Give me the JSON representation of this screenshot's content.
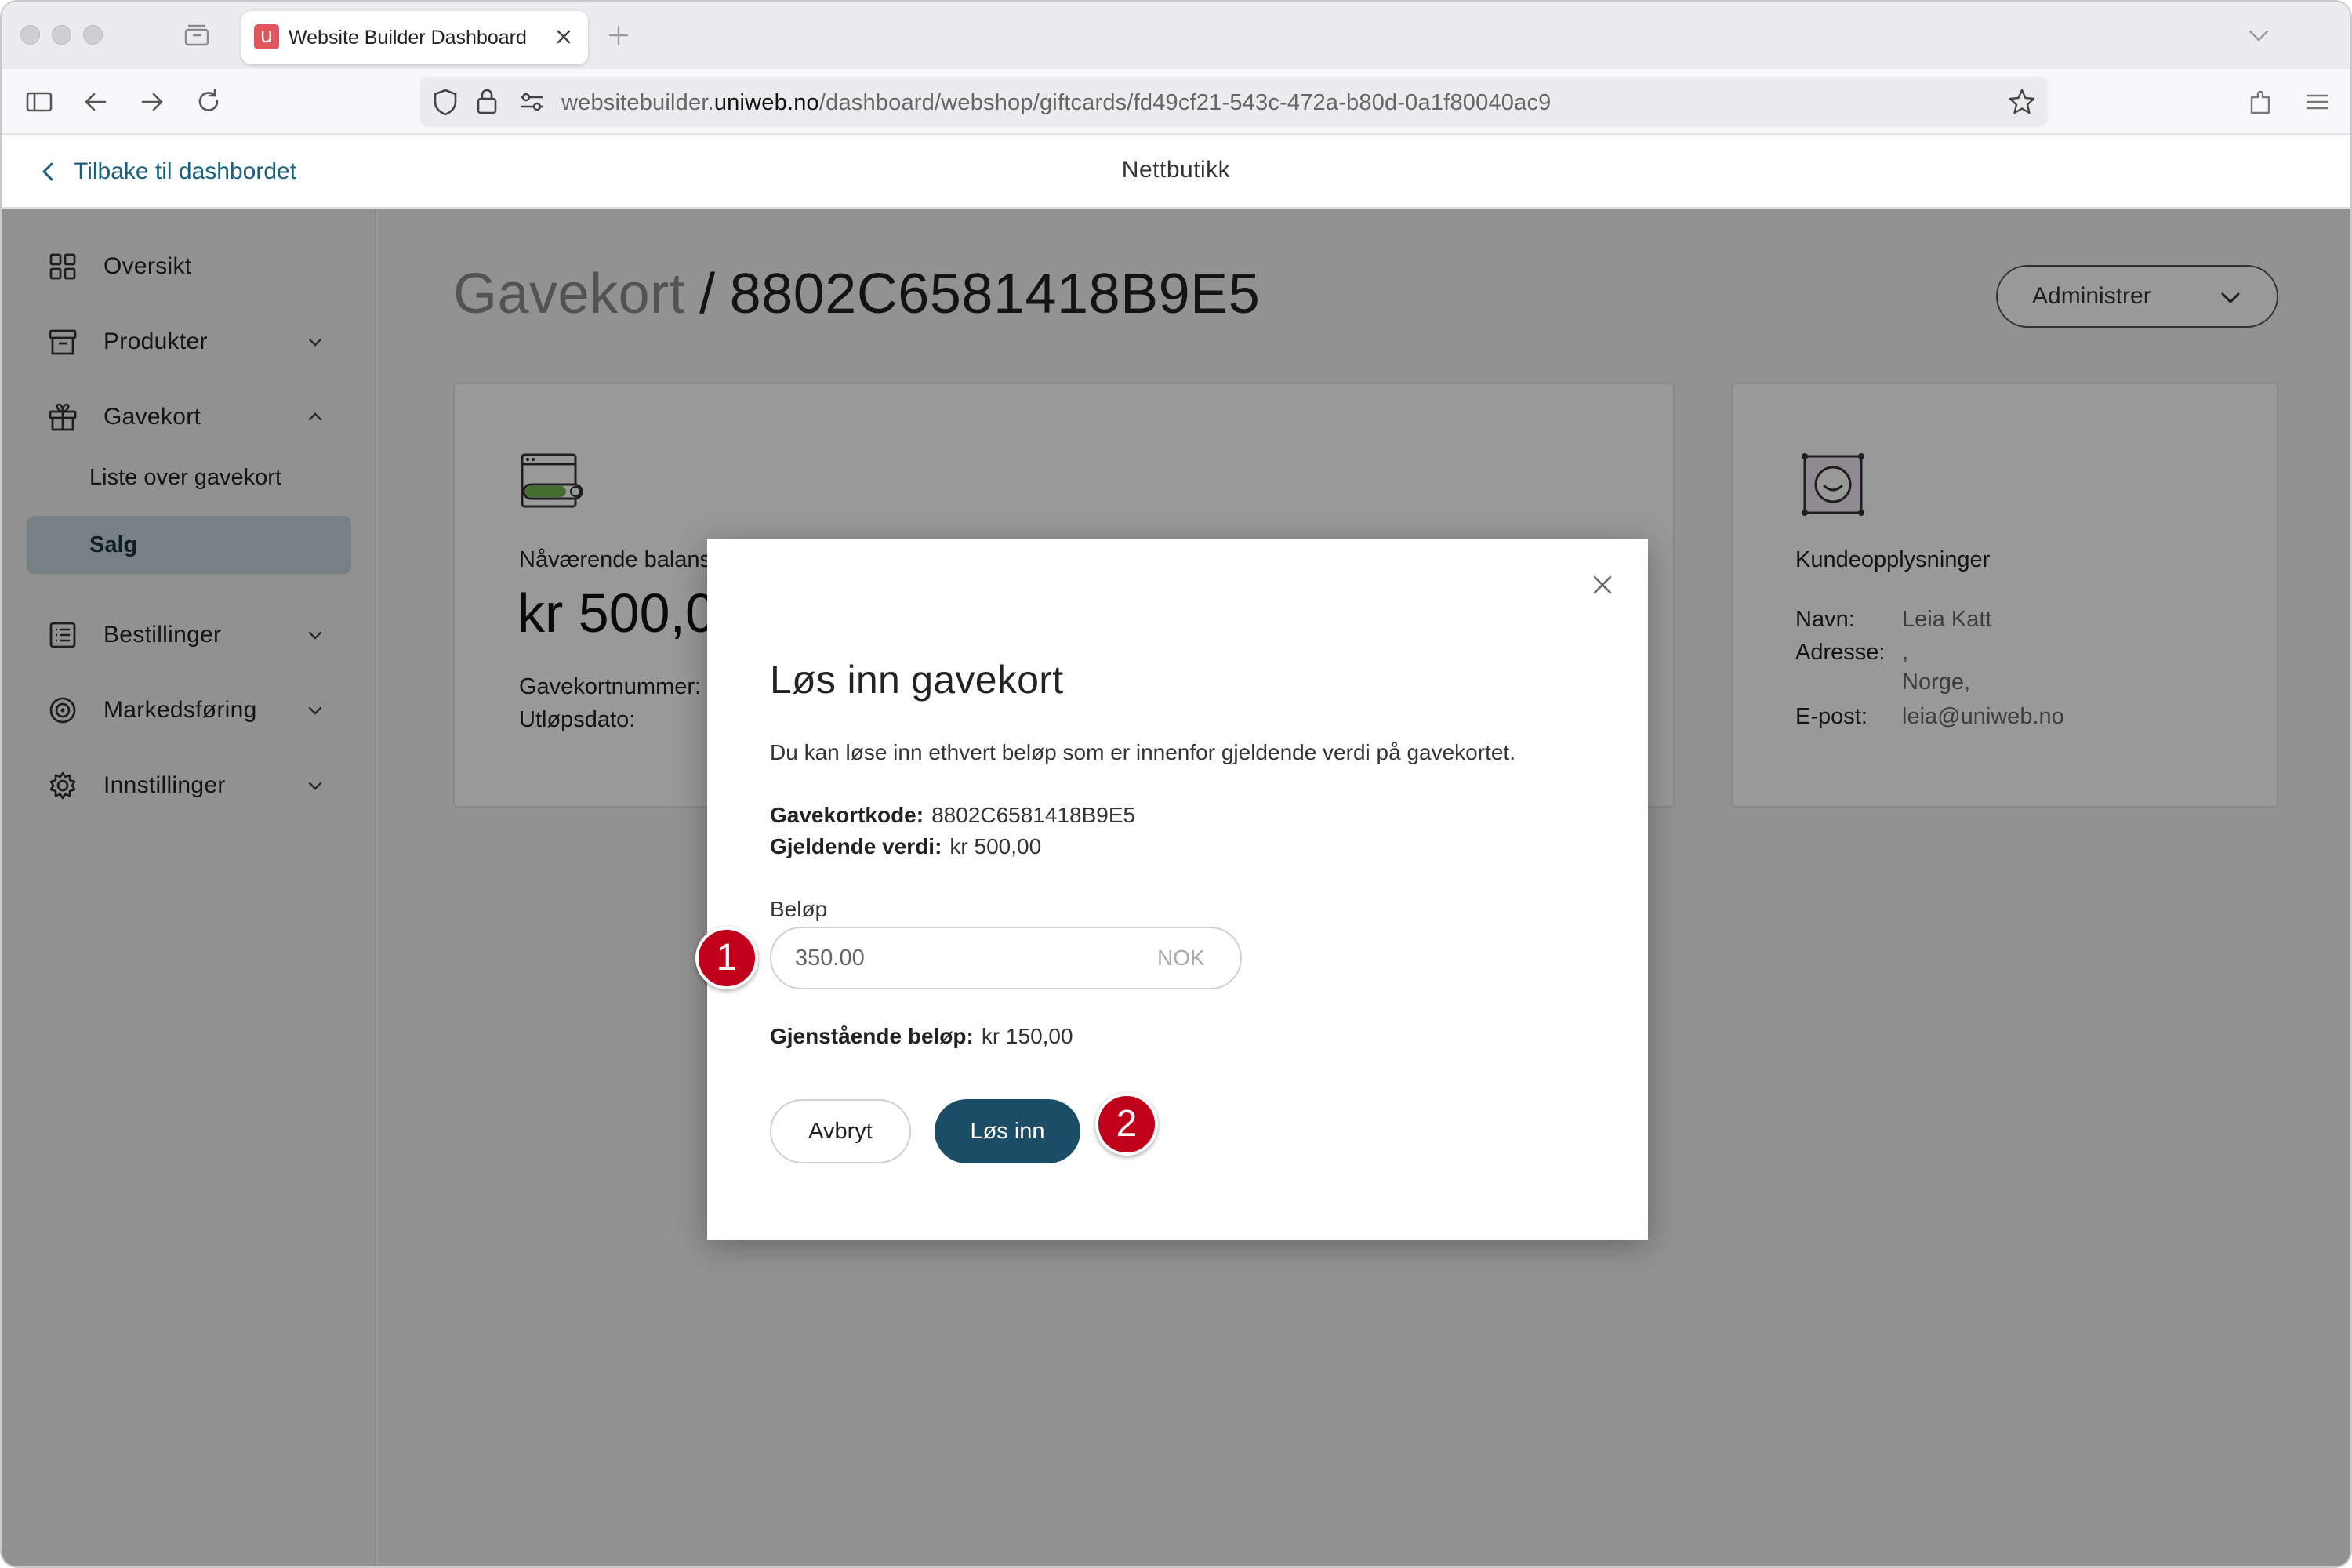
{
  "browser": {
    "tab_title": "Website Builder Dashboard",
    "favicon_letter": "u",
    "url_prefix": "websitebuilder.",
    "url_domain": "uniweb.no",
    "url_path": "/dashboard/webshop/giftcards/fd49cf21-543c-472a-b80d-0a1f80040ac9"
  },
  "header": {
    "back_label": "Tilbake til dashbordet",
    "title": "Nettbutikk"
  },
  "sidebar": {
    "items": [
      {
        "label": "Oversikt",
        "icon": "grid-icon"
      },
      {
        "label": "Produkter",
        "icon": "box-icon"
      },
      {
        "label": "Gavekort",
        "icon": "gift-icon"
      },
      {
        "label": "Bestillinger",
        "icon": "list-icon"
      },
      {
        "label": "Markedsføring",
        "icon": "target-icon"
      },
      {
        "label": "Innstillinger",
        "icon": "gear-icon"
      }
    ],
    "sub_items": [
      {
        "label": "Liste over gavekort"
      },
      {
        "label": "Salg",
        "active": true
      }
    ]
  },
  "page": {
    "breadcrumb_parent": "Gavekort",
    "breadcrumb_sep": "/",
    "breadcrumb_code": "8802C6581418B9E5",
    "admin_label": "Administrer"
  },
  "balance_card": {
    "balance_label": "Nåværende balanse",
    "balance_value": "kr 500,00",
    "number_label": "Gavekortnummer:",
    "expiry_label": "Utløpsdato:"
  },
  "customer_card": {
    "title": "Kundeopplysninger",
    "name_label": "Navn:",
    "name_value": "Leia Katt",
    "address_label": "Adresse:",
    "address_line1": ",",
    "address_line2": "Norge,",
    "email_label": "E-post:",
    "email_value": "leia@uniweb.no"
  },
  "modal": {
    "title": "Løs inn gavekort",
    "description": "Du kan løse inn ethvert beløp som er innenfor gjeldende verdi på gavekortet.",
    "code_label": "Gavekortkode:",
    "code_value": "8802C6581418B9E5",
    "current_label": "Gjeldende verdi:",
    "current_value": "kr 500,00",
    "amount_label": "Beløp",
    "amount_value": "350.00",
    "currency": "NOK",
    "remaining_label": "Gjenstående beløp:",
    "remaining_value": "kr 150,00",
    "cancel_label": "Avbryt",
    "redeem_label": "Løs inn"
  },
  "annotations": {
    "step1": "1",
    "step2": "2"
  },
  "colors": {
    "accent": "#1b4e66",
    "link": "#1b5f7d",
    "badge": "#c0001a",
    "active_bg": "#c7d6de"
  }
}
